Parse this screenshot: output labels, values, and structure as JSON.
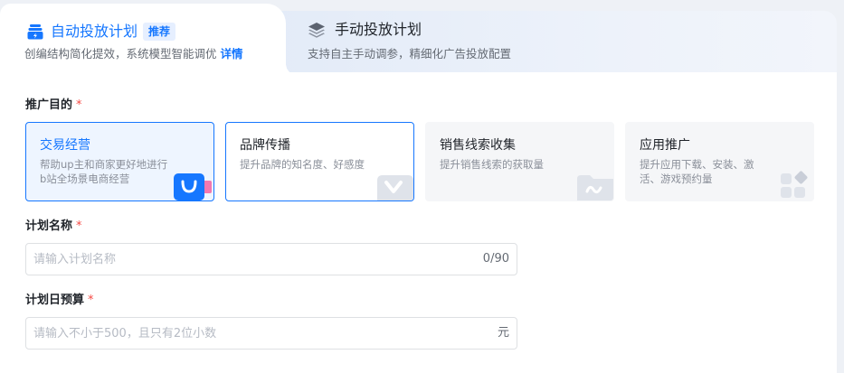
{
  "tabs": {
    "auto": {
      "title": "自动投放计划",
      "badge": "推荐",
      "subtitle": "创编结构简化提效，系统模型智能调优",
      "detail_link": "详情"
    },
    "manual": {
      "title": "手动投放计划",
      "subtitle": "支持自主手动调参，精细化广告投放配置"
    }
  },
  "form": {
    "goal": {
      "label": "推广目的",
      "required_mark": "*",
      "options": [
        {
          "title": "交易经营",
          "desc": "帮助up主和商家更好地进行b站全场景电商经营",
          "state": "selected"
        },
        {
          "title": "品牌传播",
          "desc": "提升品牌的知名度、好感度",
          "state": "outlined"
        },
        {
          "title": "销售线索收集",
          "desc": "提升销售线索的获取量",
          "state": "plain"
        },
        {
          "title": "应用推广",
          "desc": "提升应用下载、安装、激活、游戏预约量",
          "state": "plain"
        }
      ]
    },
    "plan_name": {
      "label": "计划名称",
      "required_mark": "*",
      "placeholder": "请输入计划名称",
      "value": "",
      "counter": "0/90"
    },
    "daily_budget": {
      "label": "计划日预算",
      "required_mark": "*",
      "placeholder": "请输入不小于500，且只有2位小数",
      "value": "",
      "unit": "元"
    }
  },
  "colors": {
    "accent": "#1677ff",
    "required": "#f54a45",
    "selected_bg": "#eef5ff",
    "plain_card_bg": "#f5f6f8"
  },
  "icons": {
    "auto_tab": "auto-plan-icon",
    "manual_tab": "layers-icon"
  }
}
